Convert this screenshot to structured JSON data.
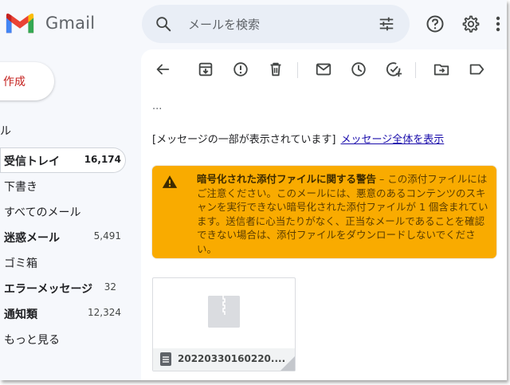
{
  "app": {
    "brand": "Gmail"
  },
  "search": {
    "placeholder": "メールを検索"
  },
  "sidebar": {
    "compose_label": "作成",
    "stub_label": "ル",
    "items": [
      {
        "label": "受信トレイ",
        "count": "16,174",
        "bold": true,
        "active": true
      },
      {
        "label": "下書き",
        "count": "",
        "bold": false,
        "active": false
      },
      {
        "label": "すべてのメール",
        "count": "",
        "bold": false,
        "active": false
      },
      {
        "label": "迷惑メール",
        "count": "5,491",
        "bold": true,
        "active": false
      },
      {
        "label": "ゴミ箱",
        "count": "",
        "bold": false,
        "active": false
      },
      {
        "label": "エラーメッセージ",
        "count": "32",
        "bold": true,
        "active": false
      },
      {
        "label": "通知類",
        "count": "12,324",
        "bold": true,
        "active": false
      },
      {
        "label": "もっと見る",
        "count": "",
        "bold": false,
        "active": false
      }
    ]
  },
  "message": {
    "ellipsis": "...",
    "clipped_notice": "[メッセージの一部が表示されています]",
    "clipped_link": "メッセージ全体を表示",
    "warning_title": "暗号化された添付ファイルに関する警告",
    "warning_body": " – この添付ファイルにはご注意ください。このメールには、悪意のあるコンテンツのスキャンを実行できない暗号化された添付ファイルが 1 個含まれています。送信者に心当たりがなく、正当なメールであることを確認できない場合は、添付ファイルをダウンロードしないでください。"
  },
  "attachment": {
    "name": "20220330160220...."
  },
  "colors": {
    "warning_bg": "#f9ab00",
    "compose_text": "#c5221f",
    "link": "#1a0dab"
  },
  "icons": [
    "gmail-logo",
    "search-icon",
    "tune-icon",
    "help-icon",
    "gear-icon",
    "apps-icon",
    "back-icon",
    "archive-icon",
    "report-spam-icon",
    "delete-icon",
    "mark-unread-icon",
    "snooze-icon",
    "add-task-icon",
    "move-to-icon",
    "label-icon",
    "warning-icon",
    "zip-file-icon"
  ]
}
